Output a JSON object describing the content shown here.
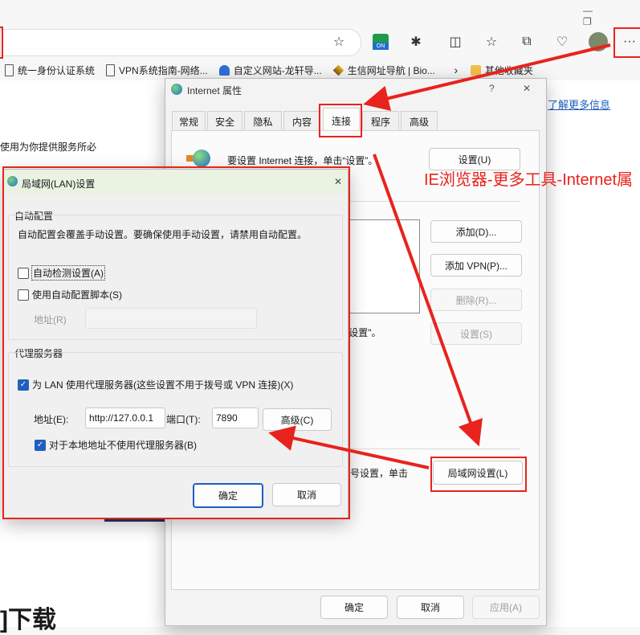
{
  "browser": {
    "menu_dots": "···",
    "bookmarks": [
      {
        "label": "统一身份认证系统",
        "icon": "doc-icon"
      },
      {
        "label": "VPN系统指南-网络...",
        "icon": "doc-icon"
      },
      {
        "label": "自定义网站-龙轩导...",
        "icon": "site-icon"
      },
      {
        "label": "生信网址导航 | Bio...",
        "icon": "layers-icon"
      }
    ],
    "other_favorites": "其他收藏夹",
    "ext_badge": "ON"
  },
  "page": {
    "learn_more": "了解更多信息",
    "body_text": "使用为你提供服务所必",
    "heading_fragment": "]下载"
  },
  "inet": {
    "title": "Internet 属性",
    "help": "?",
    "close": "✕",
    "tabs": [
      "常规",
      "安全",
      "隐私",
      "内容",
      "连接",
      "程序",
      "高级"
    ],
    "setup_text": "要设置 Internet 连接，单击“设置”。",
    "setup_btn": "设置(U)",
    "add_btn": "添加(D)...",
    "add_vpn_btn": "添加 VPN(P)...",
    "remove_btn": "删除(R)...",
    "settings_btn": "设置(S)",
    "settings_hint": "\"设置\"。",
    "lan_hint": "号设置，单击",
    "lan_btn": "局域网设置(L)",
    "ok": "确定",
    "cancel": "取消",
    "apply": "应用(A)"
  },
  "annotation": {
    "text": "IE浏览器-更多工具-Internet属",
    "color": "#e8231d"
  },
  "lan": {
    "title": "局域网(LAN)设置",
    "close": "✕",
    "auto_group": "自动配置",
    "auto_desc": "自动配置会覆盖手动设置。要确保使用手动设置，请禁用自动配置。",
    "auto_detect": "自动检测设置(A)",
    "auto_detect_checked": false,
    "auto_script": "使用自动配置脚本(S)",
    "auto_script_checked": false,
    "address_label": "地址(R)",
    "address_value": "",
    "proxy_group": "代理服务器",
    "use_proxy": "为 LAN 使用代理服务器(这些设置不用于拨号或 VPN 连接)(X)",
    "use_proxy_checked": true,
    "proxy_address_label": "地址(E):",
    "proxy_address_value": "http://127.0.0.1",
    "port_label": "端口(T):",
    "port_value": "7890",
    "advanced_btn": "高级(C)",
    "bypass_local": "对于本地地址不使用代理服务器(B)",
    "bypass_local_checked": true,
    "ok": "确定",
    "cancel": "取消"
  }
}
